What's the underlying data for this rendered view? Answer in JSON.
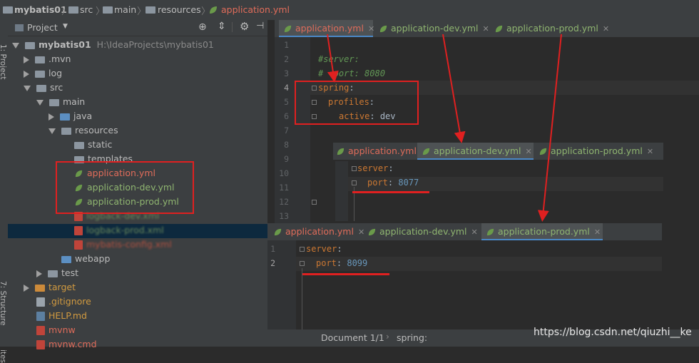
{
  "breadcrumb": {
    "items": [
      "mybatis01",
      "src",
      "main",
      "resources",
      "application.yml"
    ]
  },
  "left_strip": {
    "project_label": "1: Project",
    "structure_label": "7: Structure",
    "favorites_label": "ites"
  },
  "project_panel": {
    "title": "Project",
    "root_name": "mybatis01",
    "root_path": "H:\\IdeaProjects\\mybatis01",
    "items": {
      "mvn": ".mvn",
      "log": "log",
      "src": "src",
      "main": "main",
      "java": "java",
      "resources": "resources",
      "static": "static",
      "templates": "templates",
      "app_yml": "application.yml",
      "app_dev_yml": "application-dev.yml",
      "app_prod_yml": "application-prod.yml",
      "logback_dev": "logback-dev.xml",
      "logback_prod": "logback-prod.xml",
      "mybatis_config": "mybatis-config.xml",
      "webapp": "webapp",
      "test": "test",
      "target": "target",
      "gitignore": ".gitignore",
      "help": "HELP.md",
      "mvnw": "mvnw",
      "mvnw_cmd": "mvnw.cmd"
    }
  },
  "editor1": {
    "tabs": [
      "application.yml",
      "application-dev.yml",
      "application-prod.yml"
    ],
    "line_numbers": [
      "1",
      "2",
      "3",
      "4",
      "5",
      "6",
      "7",
      "8",
      "9",
      "10",
      "11",
      "12",
      "13"
    ],
    "lines": {
      "l2": "#server:",
      "l3": "#  port: 8080",
      "l4_key": "spring",
      "l5_key": "profiles",
      "l6_key": "active",
      "l6_val": "dev"
    }
  },
  "editor2": {
    "tabs": [
      "application.yml",
      "application-dev.yml",
      "application-prod.yml"
    ],
    "l1_key": "server",
    "l2_key": "port",
    "l2_val": "8077"
  },
  "editor3": {
    "tabs": [
      "application.yml",
      "application-dev.yml",
      "application-prod.yml"
    ],
    "line_numbers": [
      "1",
      "2"
    ],
    "l1_key": "server",
    "l2_key": "port",
    "l2_val": "8099"
  },
  "status": {
    "document": "Document 1/1",
    "path": "spring:"
  },
  "watermark": "https://blog.csdn.net/qiuzhi__ke",
  "colors": {
    "accent": "#4a88c7",
    "annotation_red": "#e02020"
  }
}
